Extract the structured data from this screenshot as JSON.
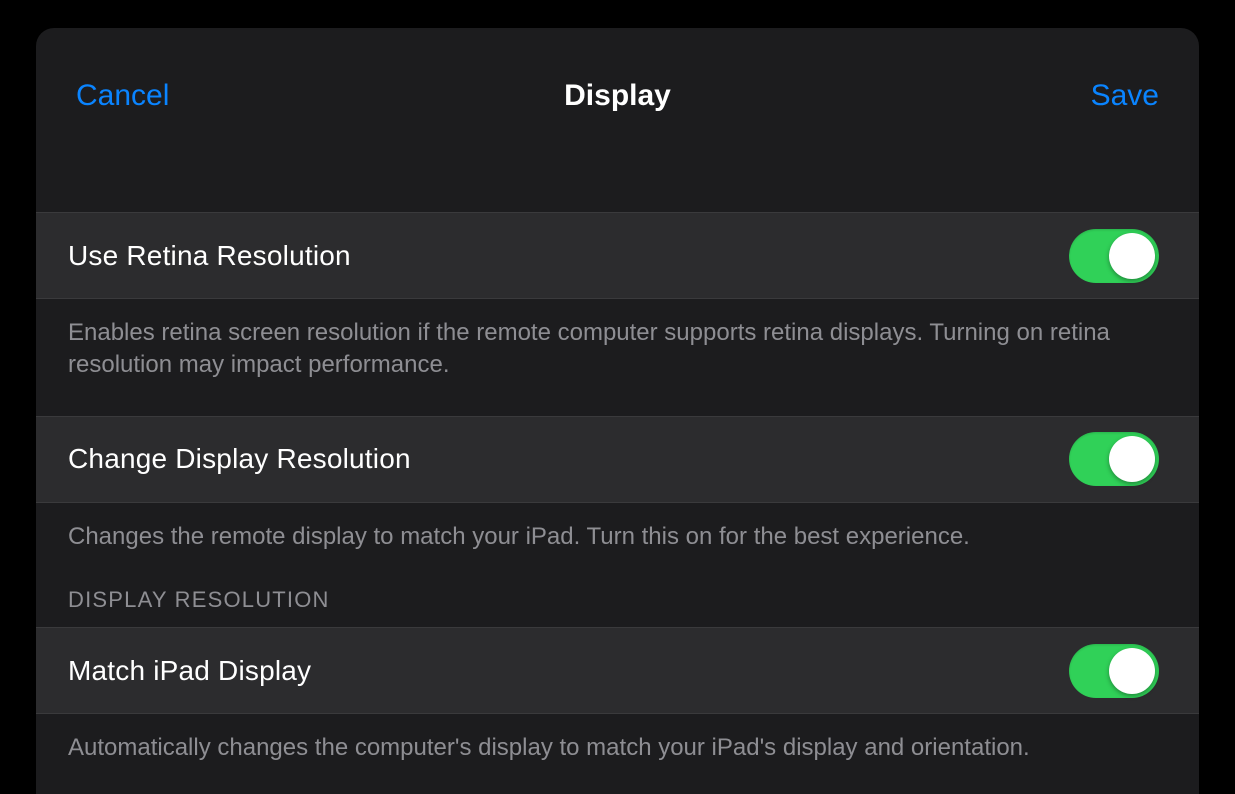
{
  "header": {
    "cancel_label": "Cancel",
    "title": "Display",
    "save_label": "Save"
  },
  "rows": {
    "retina": {
      "label": "Use Retina Resolution",
      "footer": "Enables retina screen resolution if the remote computer supports retina displays. Turning on retina resolution may impact performance.",
      "on": true
    },
    "change_res": {
      "label": "Change Display Resolution",
      "footer": "Changes the remote display to match your iPad. Turn this on for the best experience.",
      "on": true
    },
    "match_ipad": {
      "label": "Match iPad Display",
      "footer": "Automatically changes the computer's display to match your iPad's display and orientation.",
      "on": true
    }
  },
  "section_header": "DISPLAY RESOLUTION"
}
